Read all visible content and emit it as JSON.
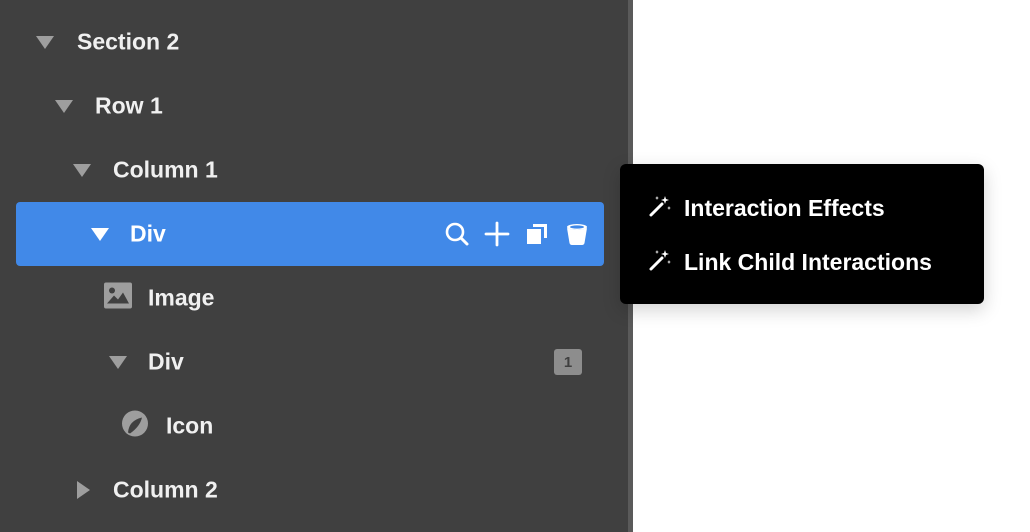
{
  "navigator": {
    "items": [
      {
        "label": "Section 2",
        "icon": "triangle-down"
      },
      {
        "label": "Row 1",
        "icon": "triangle-down"
      },
      {
        "label": "Column 1",
        "icon": "triangle-down"
      },
      {
        "label": "Div",
        "icon": "triangle-down",
        "selected": true
      },
      {
        "label": "Image",
        "icon": "image-icon"
      },
      {
        "label": "Div",
        "icon": "triangle-down",
        "badge": "1"
      },
      {
        "label": "Icon",
        "icon": "icon-element-icon"
      },
      {
        "label": "Column 2",
        "icon": "triangle-right"
      }
    ],
    "selected_actions": [
      "search-icon",
      "add-icon",
      "duplicate-icon",
      "delete-icon"
    ]
  },
  "context_menu": {
    "items": [
      {
        "label": "Interaction Effects",
        "icon": "magic-wand-icon"
      },
      {
        "label": "Link Child Interactions",
        "icon": "magic-wand-icon"
      }
    ]
  },
  "colors": {
    "panel_bg": "#404040",
    "selected_bg": "#4189e8",
    "menu_bg": "#000000",
    "text": "#f0f0f0",
    "canvas_bg": "#ffffff"
  }
}
